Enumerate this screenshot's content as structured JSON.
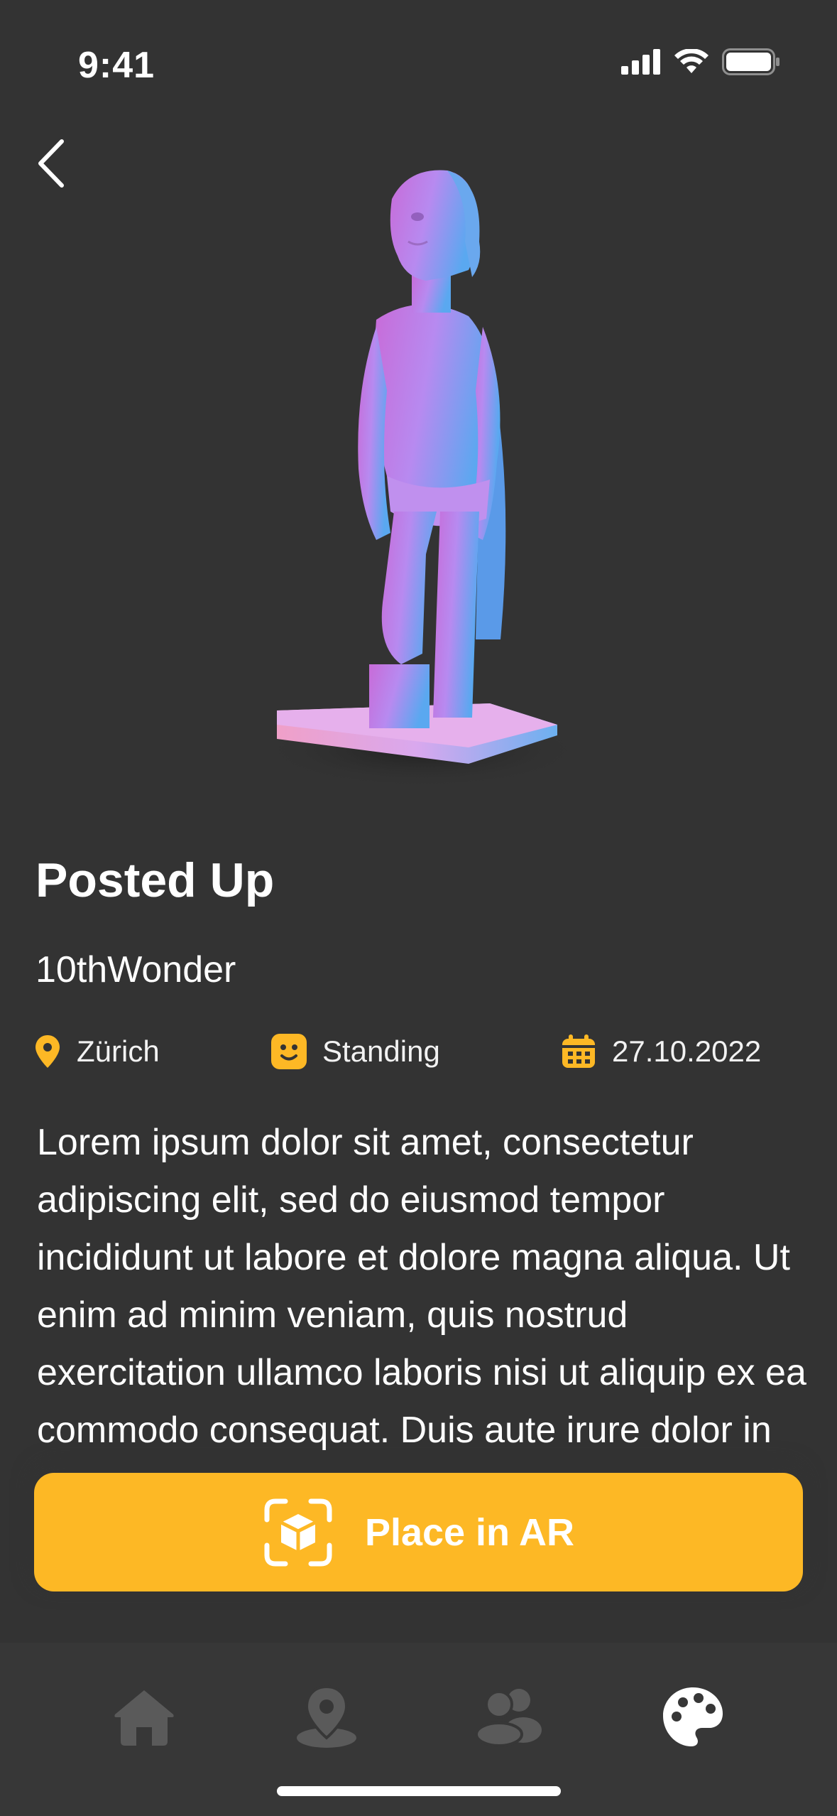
{
  "status_bar": {
    "time": "9:41"
  },
  "artwork": {
    "title": "Posted Up",
    "artist": "10thWonder",
    "location": "Zürich",
    "pose": "Standing",
    "date": "27.10.2022",
    "description": "Lorem ipsum dolor sit amet, consectetur adipiscing elit, sed do eiusmod tempor incididunt ut labore et dolore magna aliqua. Ut enim ad minim veniam, quis nostrud exercitation ullamco laboris nisi ut aliquip ex ea commodo consequat. Duis aute irure dolor in reprehenderit in voluptate velit esse cillum dolore eu fugiat nulla"
  },
  "actions": {
    "place_ar_label": "Place in AR"
  },
  "nav": {
    "items": [
      {
        "icon": "home-icon",
        "active": false
      },
      {
        "icon": "map-pin-icon",
        "active": false
      },
      {
        "icon": "users-icon",
        "active": false
      },
      {
        "icon": "palette-icon",
        "active": true
      }
    ]
  },
  "colors": {
    "background": "#333333",
    "accent": "#FDB825",
    "nav_background": "#373737",
    "nav_inactive": "#5a5a5a",
    "nav_active": "#ffffff"
  }
}
